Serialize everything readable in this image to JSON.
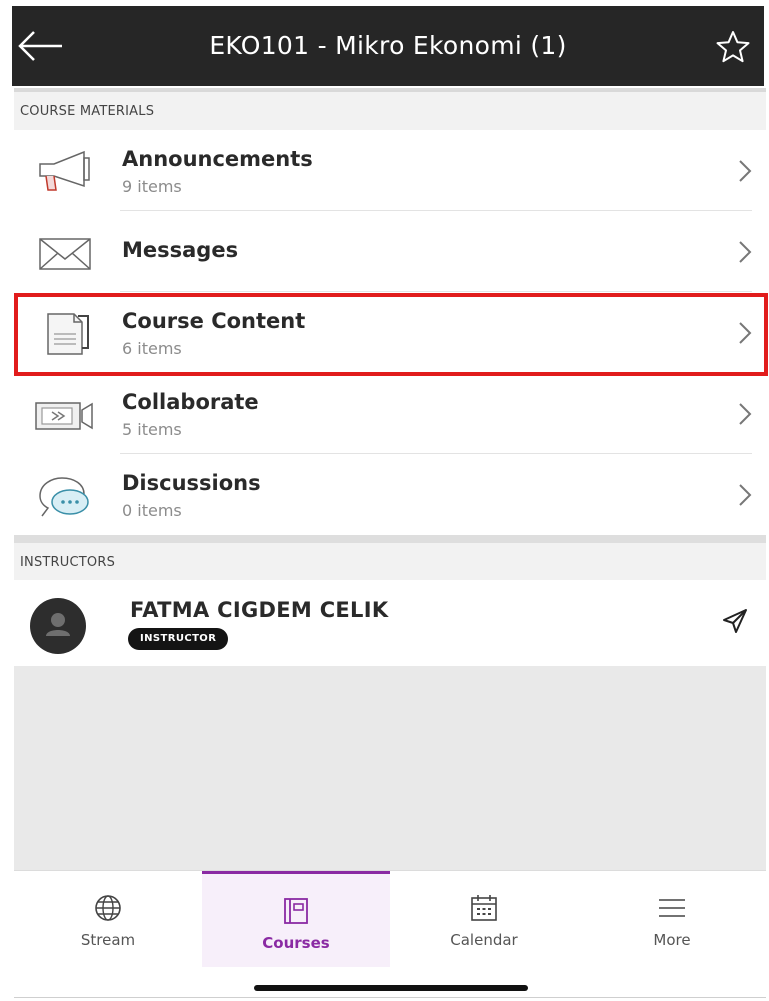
{
  "header": {
    "title": "EKO101 - Mikro Ekonomi (1)"
  },
  "sections": {
    "course_materials": "COURSE MATERIALS",
    "instructors": "INSTRUCTORS"
  },
  "materials": [
    {
      "title": "Announcements",
      "subtitle": "9 items",
      "icon": "megaphone-icon"
    },
    {
      "title": "Messages",
      "subtitle": "",
      "icon": "envelope-icon"
    },
    {
      "title": "Course Content",
      "subtitle": "6 items",
      "icon": "document-icon"
    },
    {
      "title": "Collaborate",
      "subtitle": "5 items",
      "icon": "video-icon"
    },
    {
      "title": "Discussions",
      "subtitle": "0 items",
      "icon": "chat-bubbles-icon"
    }
  ],
  "instructor": {
    "name": "FATMA CIGDEM CELIK",
    "role": "INSTRUCTOR"
  },
  "tabs": [
    {
      "label": "Stream",
      "icon": "globe-icon"
    },
    {
      "label": "Courses",
      "icon": "courses-icon",
      "active": true
    },
    {
      "label": "Calendar",
      "icon": "calendar-icon"
    },
    {
      "label": "More",
      "icon": "hamburger-icon"
    }
  ],
  "colors": {
    "header_bg": "#262626",
    "accent": "#8a2aa3",
    "highlight": "#e11c1c"
  }
}
